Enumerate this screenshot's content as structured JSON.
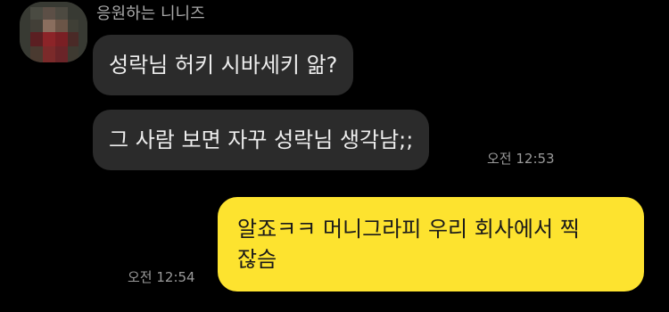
{
  "sender": {
    "name": "응원하는 니니즈"
  },
  "messages_in": [
    {
      "text": "성락님 허키 시바세키 앎?"
    },
    {
      "text": "그 사람 보면 자꾸 성락님 생각남;;",
      "time": "오전 12:53"
    }
  ],
  "message_out": {
    "line1": "알죠ㅋㅋ 머니그라피 우리 회사에서 찍",
    "line2": "잖슴",
    "time": "오전 12:54"
  },
  "colors": {
    "background": "#000000",
    "incoming_bubble": "#2b2b2b",
    "outgoing_bubble": "#fde32f"
  }
}
